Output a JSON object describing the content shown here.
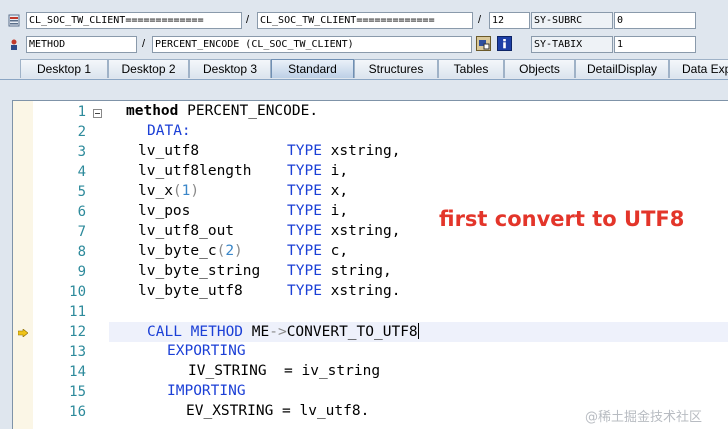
{
  "toolbar_row1": {
    "field1": "CL_SOC_TW_CLIENT=============",
    "sep1": "/",
    "field2": "CL_SOC_TW_CLIENT=============",
    "sep2": "/",
    "field3": "12",
    "sysvar_name": "SY-SUBRC",
    "sysvar_value": "0"
  },
  "toolbar_row2": {
    "type_field": "METHOD",
    "sep": "/",
    "name_field": "PERCENT_ENCODE (CL_SOC_TW_CLIENT)",
    "sysvar_name": "SY-TABIX",
    "sysvar_value": "1"
  },
  "tabs": [
    "Desktop 1",
    "Desktop 2",
    "Desktop 3",
    "Standard",
    "Structures",
    "Tables",
    "Objects",
    "DetailDisplay",
    "Data Exp"
  ],
  "active_tab": "Standard",
  "code": {
    "line_numbers": [
      "1",
      "2",
      "3",
      "4",
      "5",
      "6",
      "7",
      "8",
      "9",
      "10",
      "11",
      "12",
      "13",
      "14",
      "15",
      "16"
    ],
    "l1_kw": "method",
    "l1_rest": " PERCENT_ENCODE.",
    "l2": "DATA:",
    "l3_var": "lv_utf8",
    "l3_type": "TYPE",
    "l3_rest": " xstring,",
    "l4_var": "lv_utf8length",
    "l4_type": "TYPE",
    "l4_rest": " i,",
    "l5_var": "lv_x",
    "l5_p1": "(",
    "l5_num": "1",
    "l5_p2": ")",
    "l5_type": "TYPE",
    "l5_rest": " x,",
    "l6_var": "lv_pos",
    "l6_type": "TYPE",
    "l6_rest": " i,",
    "l7_var": "lv_utf8_out",
    "l7_type": "TYPE",
    "l7_rest": " xstring,",
    "l8_var": "lv_byte_c",
    "l8_p1": "(",
    "l8_num": "2",
    "l8_p2": ")",
    "l8_type": "TYPE",
    "l8_rest": " c,",
    "l9_var": "lv_byte_string",
    "l9_type": "TYPE",
    "l9_rest": " string,",
    "l10_var": "lv_byte_utf8",
    "l10_type": "TYPE",
    "l10_rest": " xstring.",
    "l12_kw": "CALL METHOD",
    "l12_me": " ME",
    "l12_op": "->",
    "l12_rest": "CONVERT_TO_UTF8",
    "l13": "EXPORTING",
    "l14": "IV_STRING  = iv_string",
    "l15": "IMPORTING",
    "l16": "EV_XSTRING = lv_utf8."
  },
  "annotation": "first convert to UTF8",
  "watermark": "@稀土掘金技术社区",
  "colors": {
    "keyword": "#1b3fd6",
    "annotation": "#e3352a",
    "line_number": "#2d8a9b"
  }
}
